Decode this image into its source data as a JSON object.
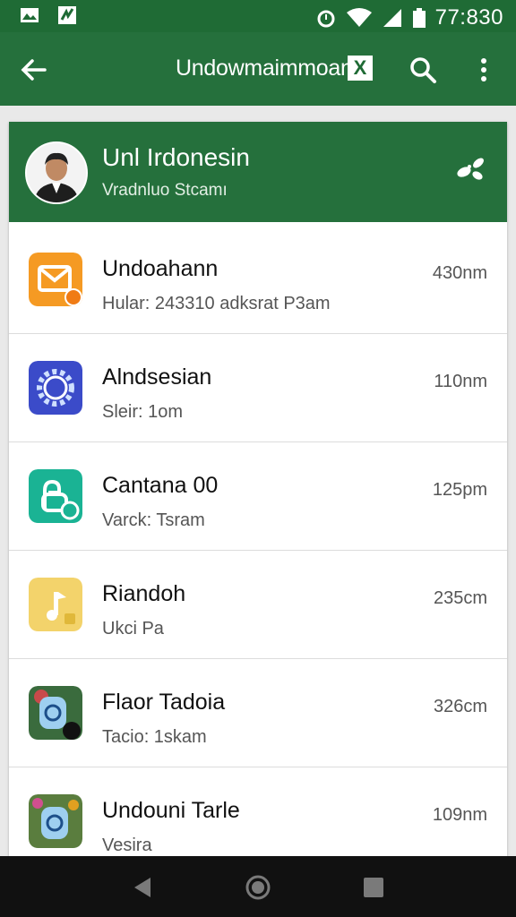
{
  "status_bar": {
    "time": "77:830"
  },
  "app_bar": {
    "title": "Undowmaimmoan",
    "badge": "X"
  },
  "header": {
    "name": "Unl Irdonesin",
    "subtitle": "Vradnluo Stcamı"
  },
  "items": [
    {
      "title": "Undoahann",
      "subtitle": "Hular: 243310 adksrat P3am",
      "time": "430nm",
      "color": "#f59a23",
      "icon": "envelope-icon"
    },
    {
      "title": "Alndsesian",
      "subtitle": "Sleir: 1om",
      "time": "110nm",
      "color": "#3b4bc9",
      "icon": "gear-icon"
    },
    {
      "title": "Cantana 00",
      "subtitle": "Varck: Tsram",
      "time": "125pm",
      "color": "#1ab394",
      "icon": "chat-icon"
    },
    {
      "title": "Riandoh",
      "subtitle": "Ukci Pa",
      "time": "235cm",
      "color": "#f3d36b",
      "icon": "music-icon"
    },
    {
      "title": "Flaor Tadoia",
      "subtitle": "Tacio: 1skam",
      "time": "326cm",
      "color": "#3a6b3d",
      "icon": "photo-app-icon"
    },
    {
      "title": "Undouni Tarle",
      "subtitle": "Vesira",
      "time": "109nm",
      "color": "#5a7d3e",
      "icon": "photo-app-icon"
    }
  ]
}
